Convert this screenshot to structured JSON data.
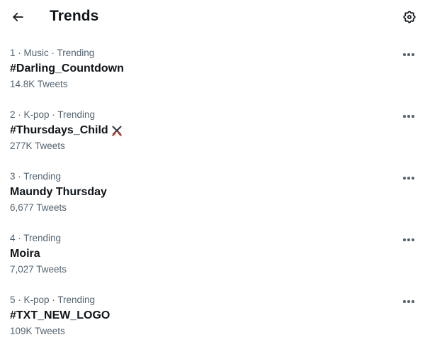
{
  "header": {
    "title": "Trends",
    "back_icon": "arrow-left-icon",
    "settings_icon": "gear-icon"
  },
  "trends": [
    {
      "meta": "1 · Music · Trending",
      "name": "#Darling_Countdown",
      "count": "14.8K Tweets",
      "emoji": ""
    },
    {
      "meta": "2 · K-pop · Trending",
      "name": "#Thursdays_Child",
      "count": "277K Tweets",
      "emoji": "crossed-swords-icon"
    },
    {
      "meta": "3 · Trending",
      "name": "Maundy Thursday",
      "count": "6,677 Tweets",
      "emoji": ""
    },
    {
      "meta": "4 · Trending",
      "name": "Moira",
      "count": "7,027 Tweets",
      "emoji": ""
    },
    {
      "meta": "5 · K-pop · Trending",
      "name": "#TXT_NEW_LOGO",
      "count": "109K Tweets",
      "emoji": ""
    }
  ],
  "colors": {
    "primary_text": "#0f1419",
    "secondary_text": "#536471",
    "background": "#ffffff"
  }
}
